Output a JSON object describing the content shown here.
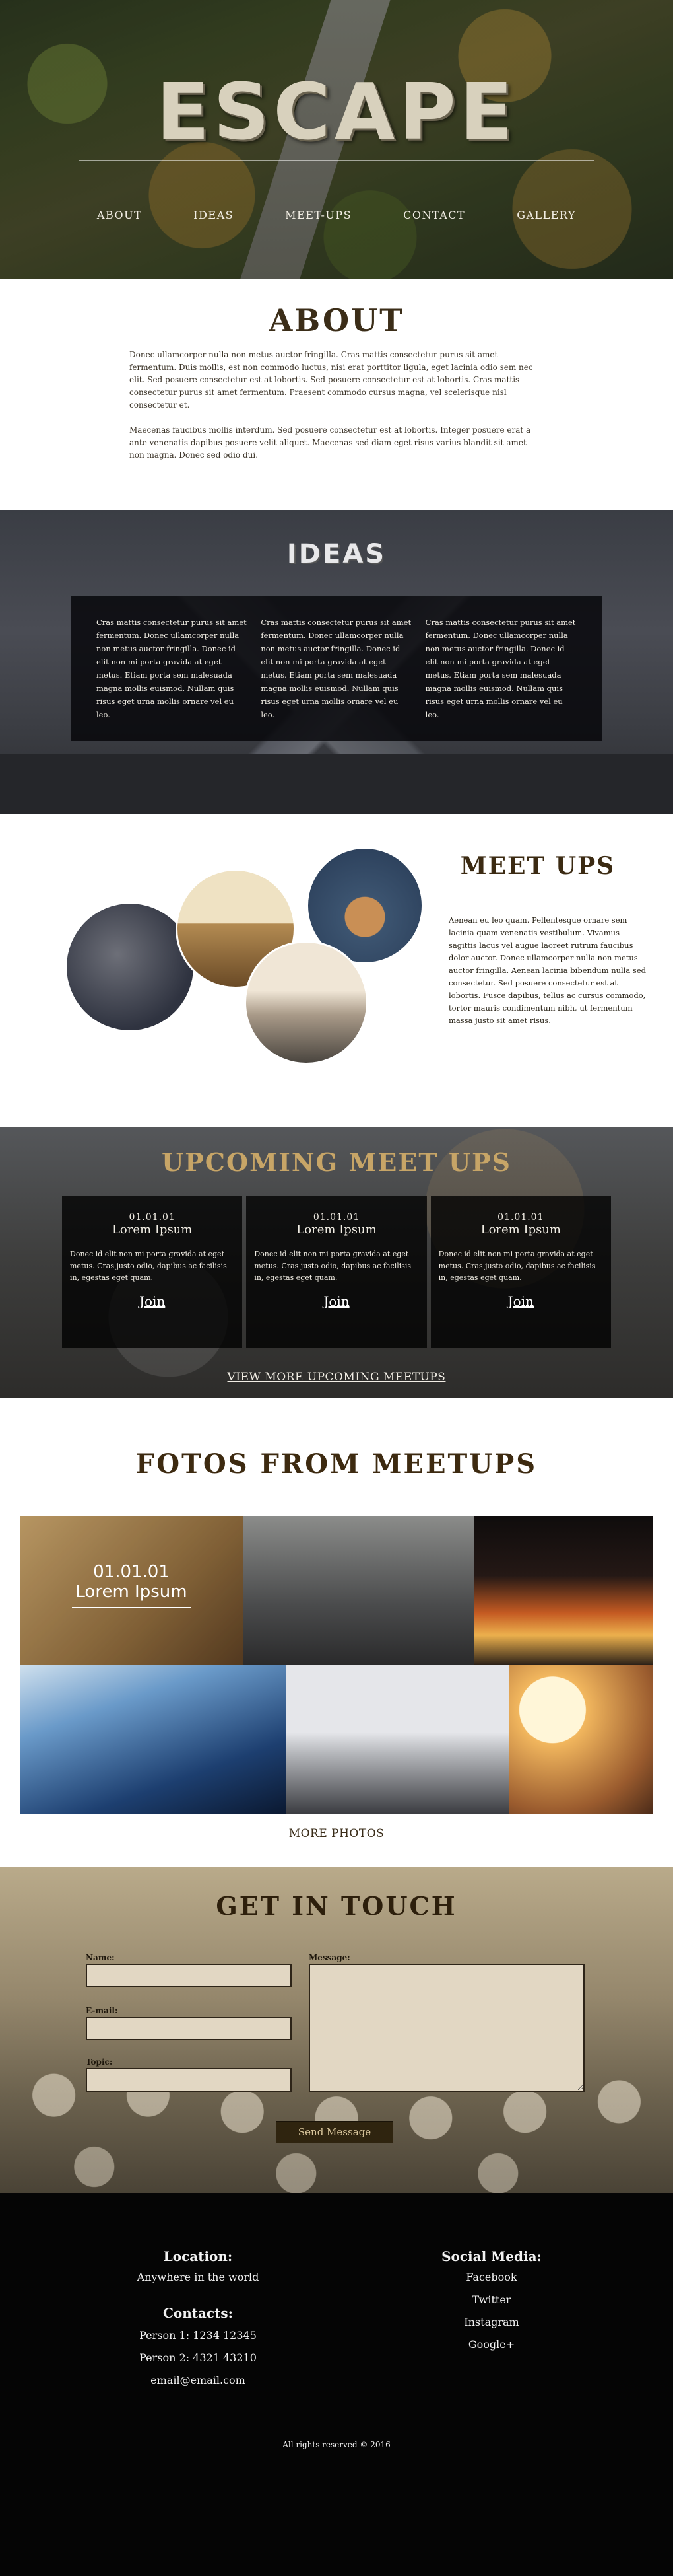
{
  "hero": {
    "title": "ESCAPE",
    "nav": [
      "ABOUT",
      "IDEAS",
      "MEET-UPS",
      "CONTACT",
      "GALLERY"
    ]
  },
  "about": {
    "title": "ABOUT",
    "paragraphs": [
      "Donec ullamcorper nulla non metus auctor fringilla. Cras mattis consectetur purus sit amet fermentum. Duis mollis, est non commodo luctus, nisi erat porttitor ligula, eget lacinia odio sem nec elit. Sed posuere consectetur est at lobortis. Sed posuere consectetur est at lobortis. Cras mattis consectetur purus sit amet fermentum. Praesent commodo cursus magna, vel scelerisque nisl consectetur et.",
      "Maecenas faucibus mollis interdum. Sed posuere consectetur est at lobortis. Integer posuere erat a ante venenatis dapibus posuere velit aliquet. Maecenas sed diam eget risus varius blandit sit amet non magna. Donec sed odio dui."
    ]
  },
  "ideas": {
    "title": "IDEAS",
    "columns": [
      "Cras mattis consectetur purus sit amet fermentum. Donec ullamcorper nulla non metus auctor fringilla. Donec id elit non mi porta gravida at eget metus. Etiam porta sem malesuada magna mollis euismod. Nullam quis risus eget urna mollis ornare vel eu leo.",
      "Cras mattis consectetur purus sit amet fermentum. Donec ullamcorper nulla non metus auctor fringilla. Donec id elit non mi porta gravida at eget metus. Etiam porta sem malesuada magna mollis euismod. Nullam quis risus eget urna mollis ornare vel eu leo.",
      "Cras mattis consectetur purus sit amet fermentum. Donec ullamcorper nulla non metus auctor fringilla. Donec id elit non mi porta gravida at eget metus. Etiam porta sem malesuada magna mollis euismod. Nullam quis risus eget urna mollis ornare vel eu leo."
    ]
  },
  "meetups": {
    "title": "MEET UPS",
    "text": "Aenean eu leo quam. Pellentesque ornare sem lacinia quam venenatis vestibulum. Vivamus sagittis lacus vel augue laoreet rutrum faucibus dolor auctor. Donec ullamcorper nulla non metus auctor fringilla. Aenean lacinia bibendum nulla sed consectetur. Sed posuere consectetur est at lobortis. Fusce dapibus, tellus ac cursus commodo, tortor mauris condimentum nibh, ut fermentum massa justo sit amet risus."
  },
  "upcoming": {
    "title": "UPCOMING MEET UPS",
    "cards": [
      {
        "date": "01.01.01",
        "name": "Lorem Ipsum",
        "desc": "Donec id elit non mi porta gravida at eget metus. Cras justo odio, dapibus ac facilisis in, egestas eget quam.",
        "join": "Join"
      },
      {
        "date": "01.01.01",
        "name": "Lorem Ipsum",
        "desc": "Donec id elit non mi porta gravida at eget metus. Cras justo odio, dapibus ac facilisis in, egestas eget quam.",
        "join": "Join"
      },
      {
        "date": "01.01.01",
        "name": "Lorem Ipsum",
        "desc": "Donec id elit non mi porta gravida at eget metus. Cras justo odio, dapibus ac facilisis in, egestas eget quam.",
        "join": "Join"
      }
    ],
    "view_more": "VIEW MORE UPCOMING MEETUPS"
  },
  "photos": {
    "title": "FOTOS FROM MEETUPS",
    "featured_date": "01.01.01",
    "featured_name": "Lorem Ipsum",
    "more": "MORE PHOTOS"
  },
  "contact": {
    "title": "GET IN TOUCH",
    "name_label": "Name:",
    "email_label": "E-mail:",
    "topic_label": "Topic:",
    "message_label": "Message:",
    "send": "Send Message"
  },
  "footer": {
    "location_heading": "Location:",
    "location_value": "Anywhere in the world",
    "contacts_heading": "Contacts:",
    "contacts": [
      "Person 1: 1234 12345",
      "Person 2: 4321 43210",
      "email@email.com"
    ],
    "social_heading": "Social Media:",
    "social": [
      "Facebook",
      "Twitter",
      "Instagram",
      "Google+"
    ],
    "copyright": "All rights reserved © 2016"
  }
}
